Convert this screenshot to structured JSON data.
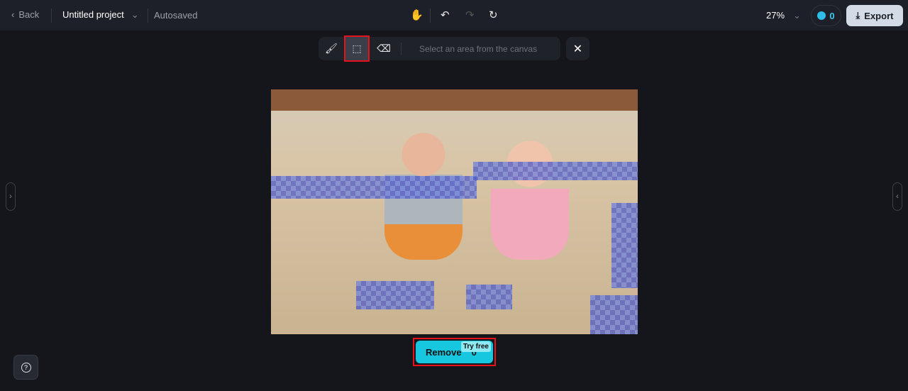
{
  "header": {
    "back_label": "Back",
    "project_name": "Untitled project",
    "save_status": "Autosaved",
    "zoom": "27%",
    "credits": "0",
    "export_label": "Export"
  },
  "toolbar": {
    "placeholder": "Select an area from the canvas"
  },
  "remove": {
    "label": "Remove",
    "badge": "Try free",
    "cost": "0"
  },
  "colors": {
    "accent": "#17c7e0",
    "highlight": "#e5121c"
  }
}
